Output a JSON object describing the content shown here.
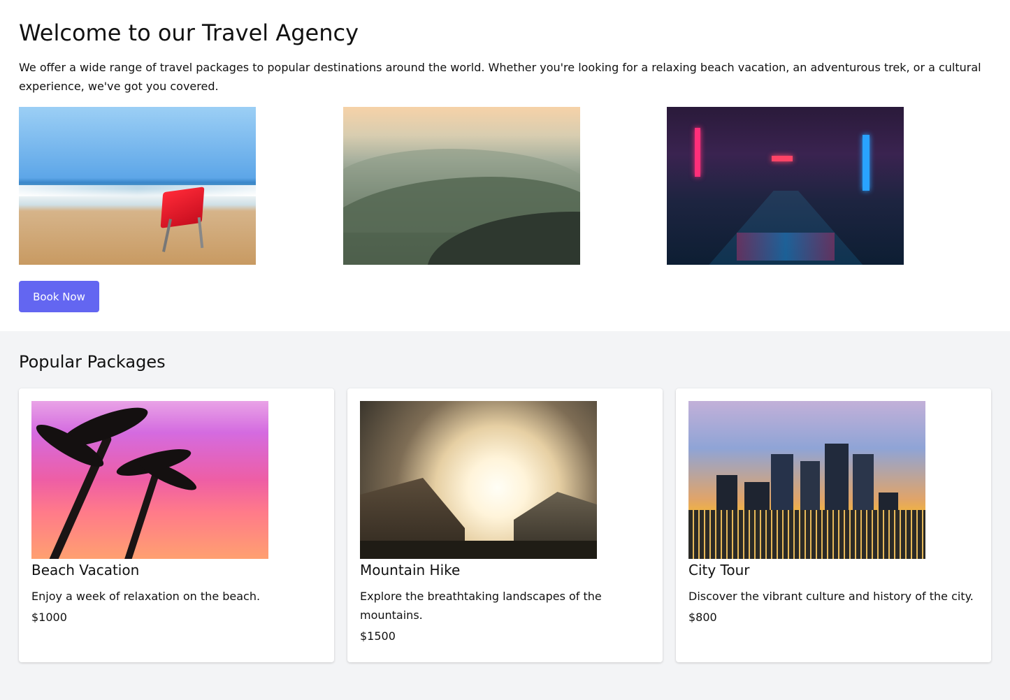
{
  "hero": {
    "title": "Welcome to our Travel Agency",
    "intro": "We offer a wide range of travel packages to popular destinations around the world. Whether you're looking for a relaxing beach vacation, an adventurous trek, or a cultural experience, we've got you covered.",
    "images": [
      "beach-photo",
      "mountains-photo",
      "city-night-photo"
    ],
    "cta_label": "Book Now"
  },
  "packages": {
    "heading": "Popular Packages",
    "items": [
      {
        "image": "palm-sunset-photo",
        "title": "Beach Vacation",
        "description": "Enjoy a week of relaxation on the beach.",
        "price": "$1000"
      },
      {
        "image": "valley-sunrise-photo",
        "title": "Mountain Hike",
        "description": "Explore the breathtaking landscapes of the mountains.",
        "price": "$1500"
      },
      {
        "image": "city-skyline-photo",
        "title": "City Tour",
        "description": "Discover the vibrant culture and history of the city.",
        "price": "$800"
      }
    ]
  },
  "colors": {
    "accent": "#6366f1",
    "page_background": "#f3f4f6",
    "card_background": "#ffffff"
  }
}
